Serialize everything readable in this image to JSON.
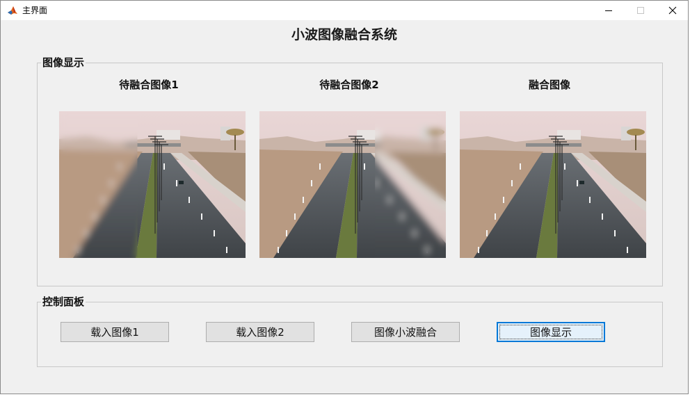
{
  "window": {
    "title": "主界面",
    "app_icon": "matlab-icon"
  },
  "title_controls": [
    "minimize-icon",
    "maximize-icon",
    "close-icon"
  ],
  "header": {
    "title": "小波图像融合系统"
  },
  "display_panel": {
    "title": "图像显示",
    "images": [
      {
        "label": "待融合图像1",
        "blur": "left"
      },
      {
        "label": "待融合图像2",
        "blur": "right"
      },
      {
        "label": "融合图像",
        "blur": "none"
      }
    ]
  },
  "control_panel": {
    "title": "控制面板",
    "buttons": [
      {
        "label": "载入图像1"
      },
      {
        "label": "载入图像2"
      },
      {
        "label": "图像小波融合"
      },
      {
        "label": "图像显示",
        "focused": true
      }
    ]
  },
  "colors": {
    "focus_border": "#0078d7",
    "window_bg": "#f0f0f0"
  }
}
